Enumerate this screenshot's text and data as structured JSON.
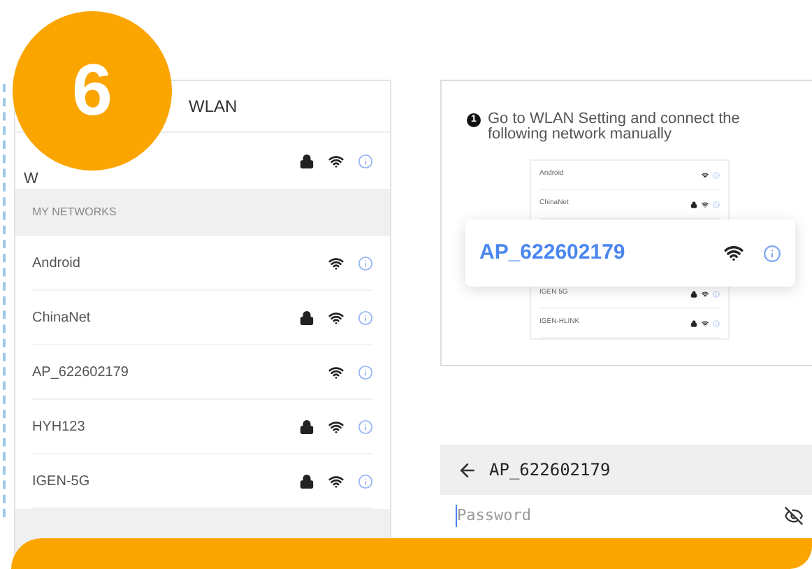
{
  "badge": "6",
  "left_panel": {
    "header": "WLAN",
    "current_network": {
      "name": "W",
      "locked": true
    },
    "section": "MY NETWORKS",
    "networks": [
      {
        "name": "Android",
        "locked": false
      },
      {
        "name": "ChinaNet",
        "locked": true
      },
      {
        "name": "AP_622602179",
        "locked": false
      },
      {
        "name": "HYH123",
        "locked": true
      },
      {
        "name": "IGEN-5G",
        "locked": true
      }
    ]
  },
  "instruction": {
    "step": "1",
    "text": "Go to WLAN Setting and connect the following network manually",
    "mini_list": [
      {
        "name": "Android",
        "locked": false
      },
      {
        "name": "ChinaNet",
        "locked": true
      },
      {
        "name": "IGEN 5G",
        "locked": true
      },
      {
        "name": "IGEN-HLINK",
        "locked": true
      }
    ],
    "highlight": {
      "name": "AP_622602179"
    }
  },
  "connect": {
    "title": "AP_622602179",
    "password": {
      "placeholder": "Password"
    }
  }
}
